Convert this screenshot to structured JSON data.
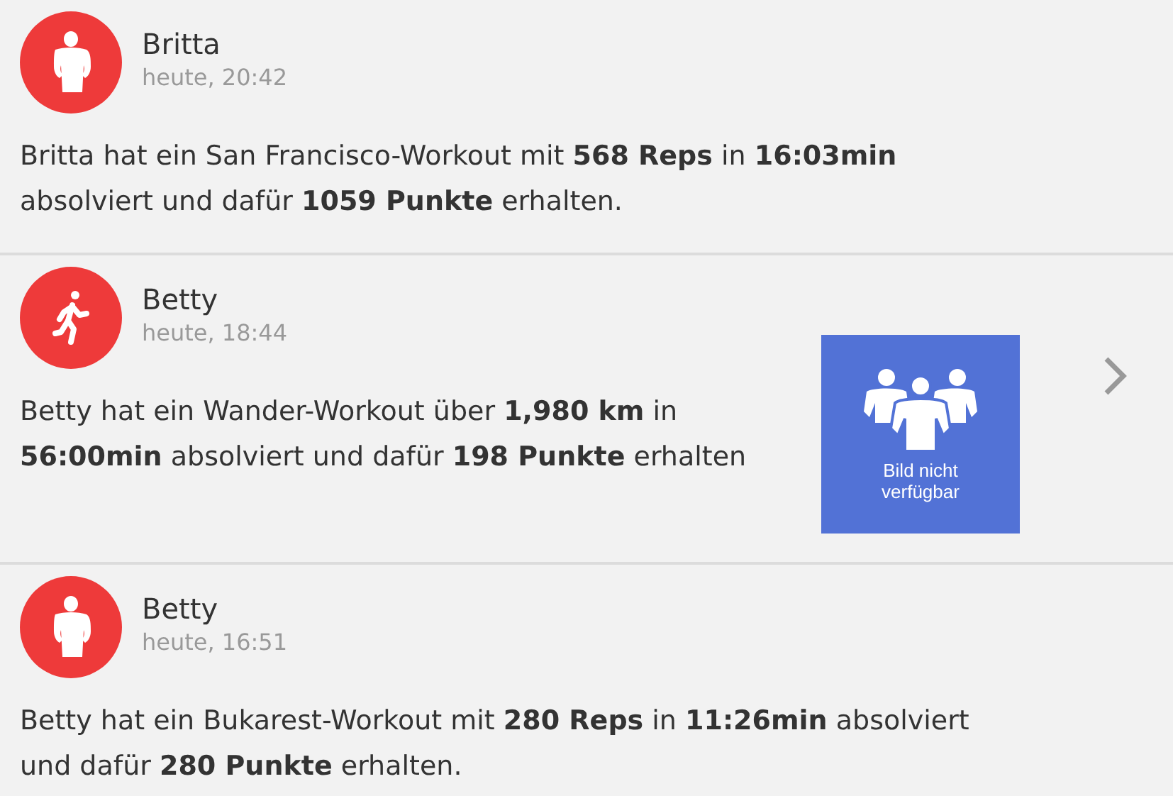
{
  "feed": [
    {
      "name": "Britta",
      "time": "heute, 20:42",
      "avatar": {
        "kind": "torso"
      },
      "message": "Britta hat ein San Francisco-Workout mit **568 Reps** in **16:03min** absolviert und dafür **1059 Punkte** erhalten.",
      "has_detail": false
    },
    {
      "name": "Betty",
      "time": "heute, 18:44",
      "avatar": {
        "kind": "runner"
      },
      "message": "Betty hat ein Wander-Workout über **1,980 km** in **56:00min** absolviert und dafür **198 Punkte** erhalten",
      "thumbnail": {
        "kind": "placeholder",
        "caption": "Bild nicht verfügbar"
      },
      "has_detail": true
    },
    {
      "name": "Betty",
      "time": "heute, 16:51",
      "avatar": {
        "kind": "torso"
      },
      "message": "Betty hat ein Bukarest-Workout mit **280 Reps** in **11:26min** absolviert und dafür **280 Punkte** erhalten.",
      "has_detail": false
    }
  ]
}
